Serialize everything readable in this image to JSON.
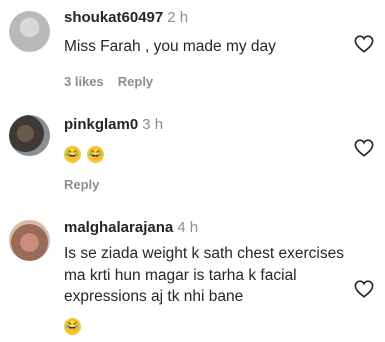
{
  "comments": [
    {
      "username": "shoukat60497",
      "time": "2 h",
      "text": "Miss Farah , you made my day",
      "likes": "3 likes",
      "reply": "Reply"
    },
    {
      "username": "pinkglam0",
      "time": "3 h",
      "emojis": "😂",
      "reply": "Reply"
    },
    {
      "username": "malghalarajana",
      "time": "4 h",
      "text": "Is se ziada weight k sath chest exercises ma krti hun magar is tarha k facial expressions aj tk nhi bane",
      "emojis": "😂"
    }
  ],
  "icons": {
    "like": "heart-outline-icon",
    "emoji": "face-with-tears-of-joy"
  },
  "colors": {
    "text": "#262626",
    "secondary": "#8e8e8e",
    "heart": "#262626"
  }
}
